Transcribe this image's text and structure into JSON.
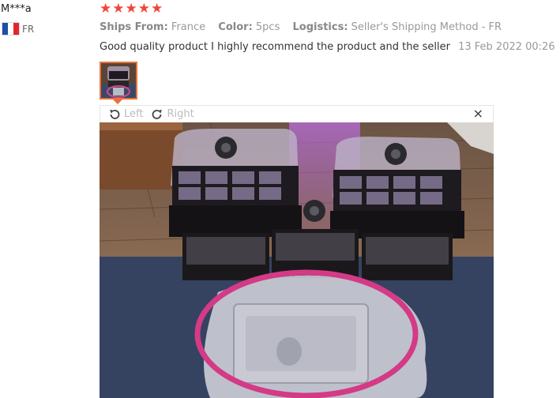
{
  "review": {
    "user_name": "M***a",
    "country_code": "FR",
    "rating": 5,
    "ships_from_label": "Ships From:",
    "ships_from_value": "France",
    "color_label": "Color:",
    "color_value": "5pcs",
    "logistics_label": "Logistics:",
    "logistics_value": "Seller's Shipping Method - FR",
    "comment": "Good quality product I highly recommend the product and the seller",
    "date": "13 Feb 2022 00:26"
  },
  "viewer": {
    "rotate_left_label": "Left",
    "rotate_right_label": "Right",
    "close_symbol": "×"
  },
  "colors": {
    "star": "#f0453a",
    "thumb_border": "#e8733a",
    "muted_text": "#999999"
  },
  "icons": [
    "star-icon",
    "flag-fr-icon",
    "rotate-left-icon",
    "rotate-right-icon",
    "close-icon"
  ]
}
